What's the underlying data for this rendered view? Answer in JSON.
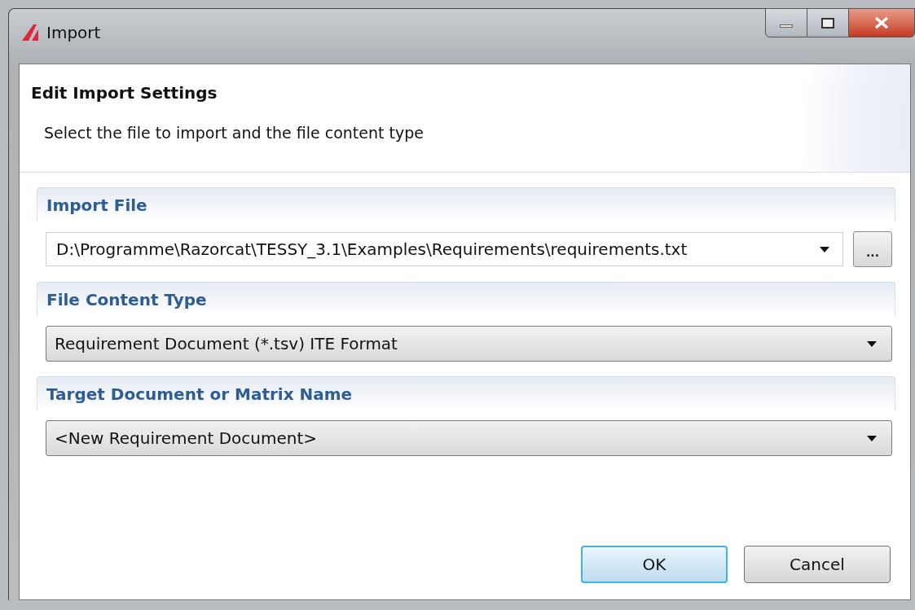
{
  "window": {
    "title": "Import"
  },
  "header": {
    "title": "Edit Import Settings",
    "description": "Select the file to import and the file content type"
  },
  "sections": [
    {
      "title": "Import File",
      "control": {
        "kind": "editable",
        "value": "D:\\Programme\\Razorcat\\TESSY_3.1\\Examples\\Requirements\\requirements.txt",
        "browse_label": "..."
      }
    },
    {
      "title": "File Content Type",
      "control": {
        "kind": "dropdown",
        "value": "Requirement Document (*.tsv) ITE Format"
      }
    },
    {
      "title": "Target Document or Matrix Name",
      "control": {
        "kind": "dropdown",
        "value": "<New Requirement Document>"
      }
    }
  ],
  "buttons": [
    {
      "label": "OK",
      "default": true
    },
    {
      "label": "Cancel",
      "default": false
    }
  ]
}
